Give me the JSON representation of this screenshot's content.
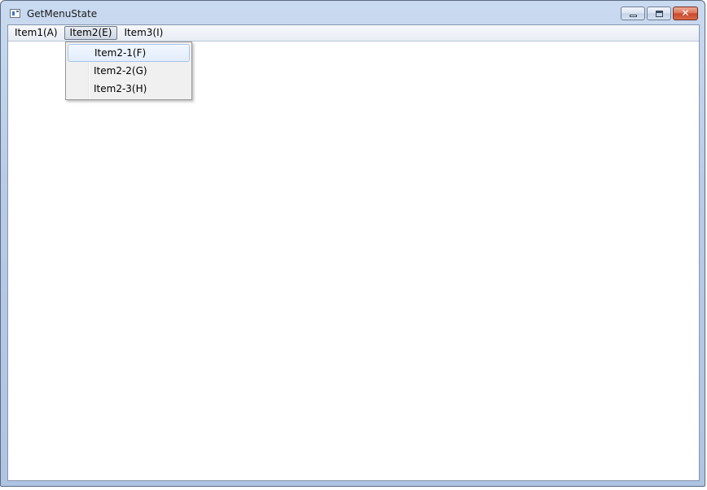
{
  "window": {
    "title": "GetMenuState"
  },
  "menubar": {
    "items": [
      {
        "label": "Item1(A)"
      },
      {
        "label": "Item2(E)"
      },
      {
        "label": "Item3(I)"
      }
    ]
  },
  "dropdown": {
    "items": [
      {
        "label": "Item2-1(F)"
      },
      {
        "label": "Item2-2(G)"
      },
      {
        "label": "Item2-3(H)"
      }
    ]
  },
  "caption": {
    "close_symbol": "✕"
  }
}
